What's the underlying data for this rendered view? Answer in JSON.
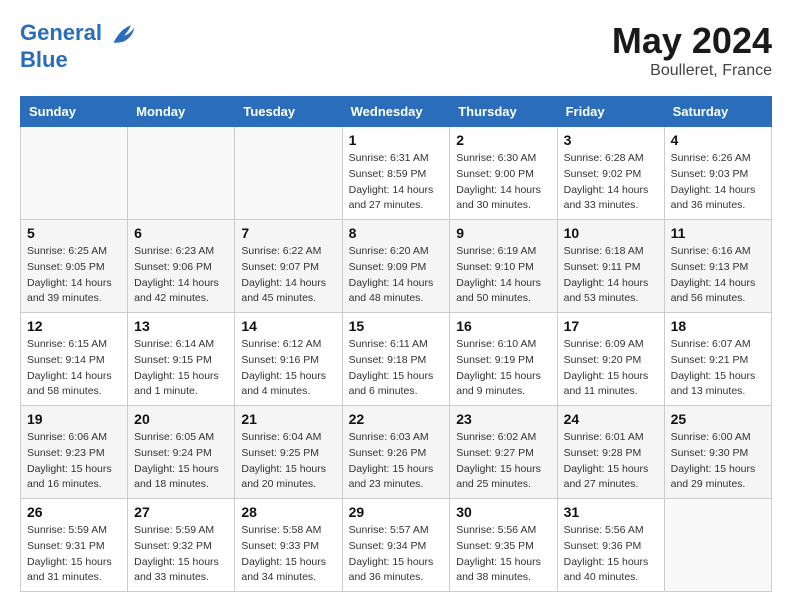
{
  "header": {
    "logo_line1": "General",
    "logo_line2": "Blue",
    "month": "May 2024",
    "location": "Boulleret, France"
  },
  "weekdays": [
    "Sunday",
    "Monday",
    "Tuesday",
    "Wednesday",
    "Thursday",
    "Friday",
    "Saturday"
  ],
  "weeks": [
    [
      {
        "num": "",
        "info": ""
      },
      {
        "num": "",
        "info": ""
      },
      {
        "num": "",
        "info": ""
      },
      {
        "num": "1",
        "info": "Sunrise: 6:31 AM\nSunset: 8:59 PM\nDaylight: 14 hours and 27 minutes."
      },
      {
        "num": "2",
        "info": "Sunrise: 6:30 AM\nSunset: 9:00 PM\nDaylight: 14 hours and 30 minutes."
      },
      {
        "num": "3",
        "info": "Sunrise: 6:28 AM\nSunset: 9:02 PM\nDaylight: 14 hours and 33 minutes."
      },
      {
        "num": "4",
        "info": "Sunrise: 6:26 AM\nSunset: 9:03 PM\nDaylight: 14 hours and 36 minutes."
      }
    ],
    [
      {
        "num": "5",
        "info": "Sunrise: 6:25 AM\nSunset: 9:05 PM\nDaylight: 14 hours and 39 minutes."
      },
      {
        "num": "6",
        "info": "Sunrise: 6:23 AM\nSunset: 9:06 PM\nDaylight: 14 hours and 42 minutes."
      },
      {
        "num": "7",
        "info": "Sunrise: 6:22 AM\nSunset: 9:07 PM\nDaylight: 14 hours and 45 minutes."
      },
      {
        "num": "8",
        "info": "Sunrise: 6:20 AM\nSunset: 9:09 PM\nDaylight: 14 hours and 48 minutes."
      },
      {
        "num": "9",
        "info": "Sunrise: 6:19 AM\nSunset: 9:10 PM\nDaylight: 14 hours and 50 minutes."
      },
      {
        "num": "10",
        "info": "Sunrise: 6:18 AM\nSunset: 9:11 PM\nDaylight: 14 hours and 53 minutes."
      },
      {
        "num": "11",
        "info": "Sunrise: 6:16 AM\nSunset: 9:13 PM\nDaylight: 14 hours and 56 minutes."
      }
    ],
    [
      {
        "num": "12",
        "info": "Sunrise: 6:15 AM\nSunset: 9:14 PM\nDaylight: 14 hours and 58 minutes."
      },
      {
        "num": "13",
        "info": "Sunrise: 6:14 AM\nSunset: 9:15 PM\nDaylight: 15 hours and 1 minute."
      },
      {
        "num": "14",
        "info": "Sunrise: 6:12 AM\nSunset: 9:16 PM\nDaylight: 15 hours and 4 minutes."
      },
      {
        "num": "15",
        "info": "Sunrise: 6:11 AM\nSunset: 9:18 PM\nDaylight: 15 hours and 6 minutes."
      },
      {
        "num": "16",
        "info": "Sunrise: 6:10 AM\nSunset: 9:19 PM\nDaylight: 15 hours and 9 minutes."
      },
      {
        "num": "17",
        "info": "Sunrise: 6:09 AM\nSunset: 9:20 PM\nDaylight: 15 hours and 11 minutes."
      },
      {
        "num": "18",
        "info": "Sunrise: 6:07 AM\nSunset: 9:21 PM\nDaylight: 15 hours and 13 minutes."
      }
    ],
    [
      {
        "num": "19",
        "info": "Sunrise: 6:06 AM\nSunset: 9:23 PM\nDaylight: 15 hours and 16 minutes."
      },
      {
        "num": "20",
        "info": "Sunrise: 6:05 AM\nSunset: 9:24 PM\nDaylight: 15 hours and 18 minutes."
      },
      {
        "num": "21",
        "info": "Sunrise: 6:04 AM\nSunset: 9:25 PM\nDaylight: 15 hours and 20 minutes."
      },
      {
        "num": "22",
        "info": "Sunrise: 6:03 AM\nSunset: 9:26 PM\nDaylight: 15 hours and 23 minutes."
      },
      {
        "num": "23",
        "info": "Sunrise: 6:02 AM\nSunset: 9:27 PM\nDaylight: 15 hours and 25 minutes."
      },
      {
        "num": "24",
        "info": "Sunrise: 6:01 AM\nSunset: 9:28 PM\nDaylight: 15 hours and 27 minutes."
      },
      {
        "num": "25",
        "info": "Sunrise: 6:00 AM\nSunset: 9:30 PM\nDaylight: 15 hours and 29 minutes."
      }
    ],
    [
      {
        "num": "26",
        "info": "Sunrise: 5:59 AM\nSunset: 9:31 PM\nDaylight: 15 hours and 31 minutes."
      },
      {
        "num": "27",
        "info": "Sunrise: 5:59 AM\nSunset: 9:32 PM\nDaylight: 15 hours and 33 minutes."
      },
      {
        "num": "28",
        "info": "Sunrise: 5:58 AM\nSunset: 9:33 PM\nDaylight: 15 hours and 34 minutes."
      },
      {
        "num": "29",
        "info": "Sunrise: 5:57 AM\nSunset: 9:34 PM\nDaylight: 15 hours and 36 minutes."
      },
      {
        "num": "30",
        "info": "Sunrise: 5:56 AM\nSunset: 9:35 PM\nDaylight: 15 hours and 38 minutes."
      },
      {
        "num": "31",
        "info": "Sunrise: 5:56 AM\nSunset: 9:36 PM\nDaylight: 15 hours and 40 minutes."
      },
      {
        "num": "",
        "info": ""
      }
    ]
  ]
}
